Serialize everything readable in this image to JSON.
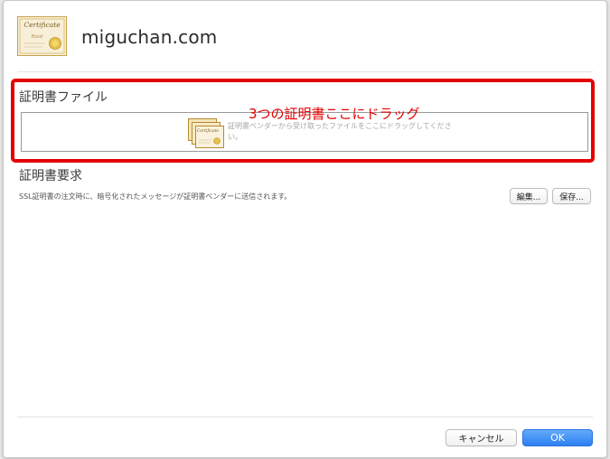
{
  "header": {
    "certificate_icon": "certificate-icon",
    "site_name": "miguchan.com"
  },
  "file_section": {
    "title": "証明書ファイル",
    "drop_icon": "certificate-stack-icon",
    "drop_hint": "証明書ベンダーから受け取ったファイルをここにドラッグしてください。"
  },
  "annotation": {
    "text": "3つの証明書ここにドラッグ",
    "color": "#e30000"
  },
  "request_section": {
    "title": "証明書要求",
    "description": "SSL証明書の注文時に、暗号化されたメッセージが証明書ベンダーに送信されます。",
    "edit_label": "編集...",
    "save_label": "保存..."
  },
  "footer": {
    "cancel_label": "キャンセル",
    "ok_label": "OK"
  },
  "colors": {
    "accent": "#2e7ff2",
    "annotation_red": "#e30000"
  }
}
